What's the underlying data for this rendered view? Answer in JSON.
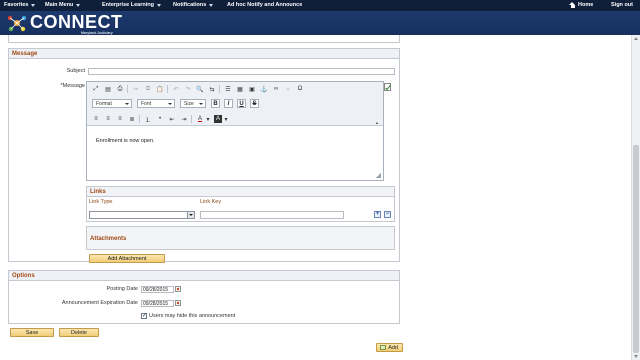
{
  "topnav": {
    "favorites": "Favorites",
    "main_menu": "Main Menu",
    "breadcrumb_1": "Enterprise Learning",
    "breadcrumb_2": "Notifications",
    "breadcrumb_3": "Ad hoc Notify and Announce",
    "home": "Home",
    "sign_out": "Sign out"
  },
  "header": {
    "brand": "CONNECT",
    "tagline": "Maryland Judiciary"
  },
  "message": {
    "section_title": "Message",
    "subject_label": "Subject",
    "subject_value": "",
    "message_label": "*Message",
    "toolbar": {
      "format": "Format",
      "font": "Font",
      "size": "Size",
      "bold": "B",
      "italic": "I",
      "underline": "U",
      "strike": "S"
    },
    "body": "Enrollment is now open."
  },
  "links": {
    "title": "Links",
    "col_type": "Link Type",
    "col_key": "Link Key",
    "type_value": "",
    "key_value": ""
  },
  "attachments": {
    "title": "Attachments",
    "add_button": "Add Attachment"
  },
  "options": {
    "title": "Options",
    "posting_label": "Posting Date",
    "posting_value": "09/28/2015",
    "expiration_label": "Announcement Expiration Date",
    "expiration_value": "09/28/2015",
    "hide_label": "Users may hide this announcement",
    "hide_checked": true
  },
  "actions": {
    "save": "Save",
    "delete": "Delete",
    "add": "Add"
  },
  "colors": {
    "nav": "#0f1f3a",
    "header": "#1d3a6e",
    "section_title": "#a14a16",
    "button": "#f1cd77"
  }
}
